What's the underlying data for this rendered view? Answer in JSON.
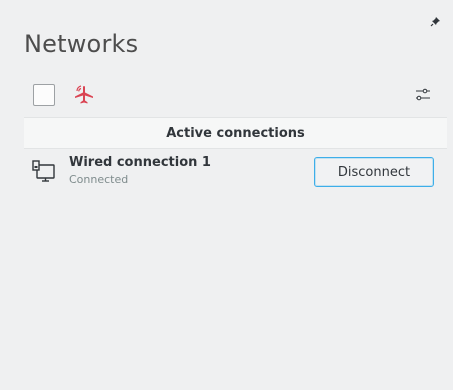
{
  "header": {
    "title": "Networks",
    "pin_icon": "pin-icon"
  },
  "toolbar": {
    "wifi_checkbox_checked": false,
    "airplane_icon": "airplane-mode-icon",
    "airplane_color": "#da4453",
    "settings_icon": "configure-icon"
  },
  "active_section": {
    "label": "Active connections"
  },
  "connections": [
    {
      "name": "Wired connection 1",
      "status": "Connected",
      "icon": "wired-network-icon",
      "action_label": "Disconnect"
    }
  ],
  "colors": {
    "background": "#eff0f1",
    "accent": "#3daee9",
    "text": "#31363b",
    "subtext": "#7f8c8d"
  }
}
